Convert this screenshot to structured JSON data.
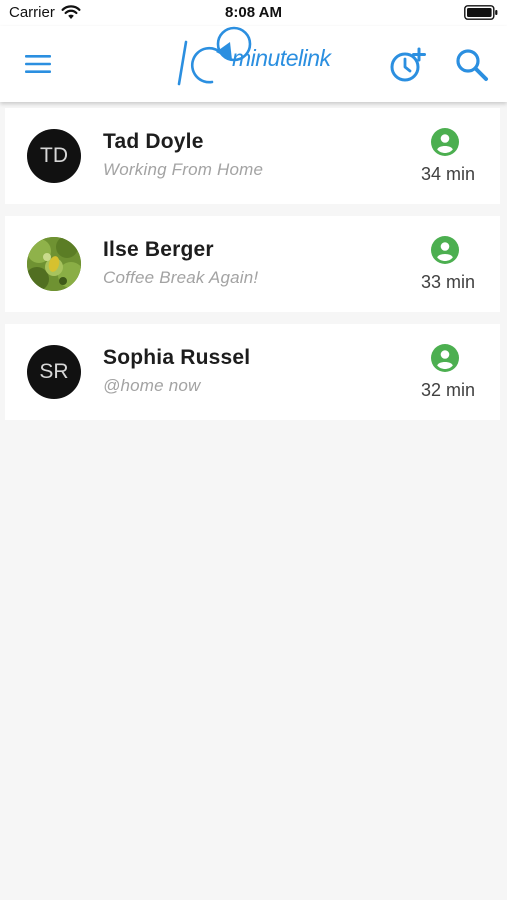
{
  "status_bar": {
    "carrier": "Carrier",
    "time": "8:08 AM",
    "wifi_icon": "wifi-icon",
    "battery_icon": "battery-icon"
  },
  "app_bar": {
    "logo_text": "minutelink",
    "logo_icon": "ten-minute-clock-logo",
    "menu_icon": "hamburger-menu-icon",
    "alarm_icon": "alarm-add-icon",
    "search_icon": "search-icon",
    "accent_color": "#2b8fe0"
  },
  "contacts": [
    {
      "initials": "TD",
      "name": "Tad Doyle",
      "status": "Working From Home",
      "time": "34 min",
      "avatar_type": "initials"
    },
    {
      "initials": "",
      "name": "Ilse Berger",
      "status": "Coffee Break Again!",
      "time": "33 min",
      "avatar_type": "photo"
    },
    {
      "initials": "SR",
      "name": "Sophia Russel",
      "status": "@home now",
      "time": "32 min",
      "avatar_type": "initials"
    }
  ],
  "colors": {
    "presence_green": "#4caf50",
    "background": "#f6f6f6",
    "card": "#ffffff"
  }
}
